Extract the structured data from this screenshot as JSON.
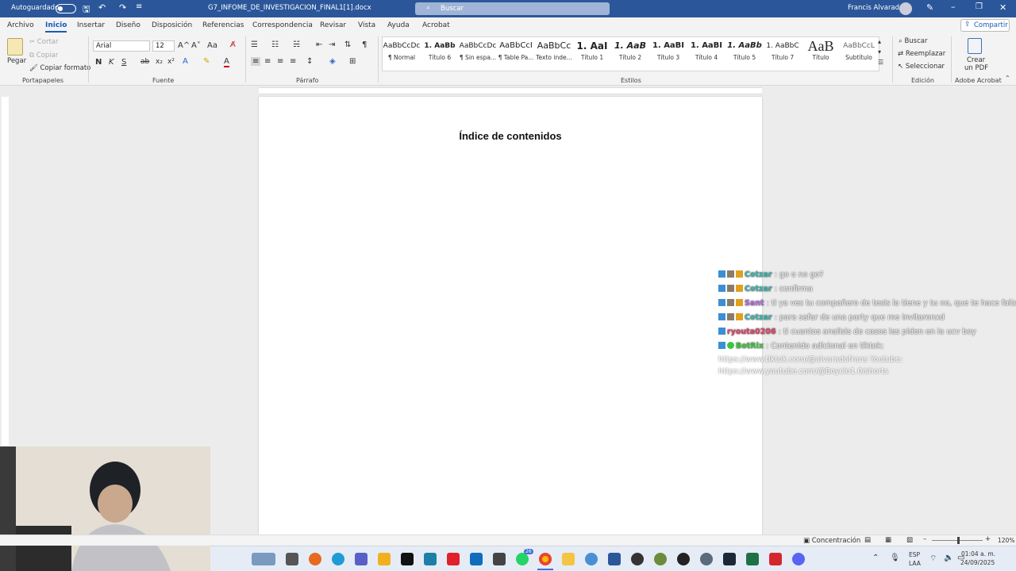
{
  "titlebar": {
    "autosave_label": "Autoguardado",
    "filename": "G7_INFOME_DE_INVESTIGACION_FINAL1[1].docx",
    "search_placeholder": "Buscar",
    "user_name": "Francis Alvarado"
  },
  "menu": {
    "tabs": [
      "Archivo",
      "Inicio",
      "Insertar",
      "Diseño",
      "Disposición",
      "Referencias",
      "Correspondencia",
      "Revisar",
      "Vista",
      "Ayuda",
      "Acrobat"
    ],
    "active": "Inicio",
    "share_label": "Compartir"
  },
  "ribbon": {
    "clipboard": {
      "paste": "Pegar",
      "cut": "Cortar",
      "copy": "Copiar",
      "format_painter": "Copiar formato",
      "group": "Portapapeles"
    },
    "font": {
      "name": "Arial",
      "size": "12",
      "bold": "N",
      "italic": "K",
      "underline": "S",
      "strike": "ab",
      "sub": "x₂",
      "sup": "x²",
      "case": "Aa",
      "grow": "A^",
      "shrink": "A˅",
      "group": "Fuente"
    },
    "paragraph": {
      "group": "Párrafo"
    },
    "styles": {
      "group": "Estilos",
      "items": [
        {
          "preview": "AaBbCcDc",
          "name": "¶ Normal"
        },
        {
          "preview": "1. AaBb",
          "name": "Título 6"
        },
        {
          "preview": "AaBbCcDc",
          "name": "¶ Sin espa..."
        },
        {
          "preview": "AaBbCcI",
          "name": "¶ Table Pa..."
        },
        {
          "preview": "AaBbCc",
          "name": "Texto inde..."
        },
        {
          "preview": "1. AaI",
          "name": "Título 1"
        },
        {
          "preview": "1. AaB",
          "name": "Título 2"
        },
        {
          "preview": "1. AaBI",
          "name": "Título 3"
        },
        {
          "preview": "1. AaBI",
          "name": "Título 4"
        },
        {
          "preview": "1. AaBb",
          "name": "Título 5"
        },
        {
          "preview": "1. AaBbC",
          "name": "Título 7"
        },
        {
          "preview": "AaB",
          "name": "Título"
        },
        {
          "preview": "AaBbCcL",
          "name": "Subtítulo"
        }
      ]
    },
    "editing": {
      "find": "Buscar",
      "replace": "Reemplazar",
      "select": "Seleccionar",
      "group": "Edición"
    },
    "acrobat": {
      "create": "Crear",
      "pdf": "un PDF",
      "group": "Adobe Acrobat"
    }
  },
  "document": {
    "heading": "Índice de contenidos"
  },
  "chat": [
    {
      "user": "Cotzar",
      "user_color": "#3bb7b0",
      "text": ": go o no go?"
    },
    {
      "user": "Cotzar",
      "user_color": "#3bb7b0",
      "text": ": confirma"
    },
    {
      "user": "Sant",
      "user_color": "#b56be0",
      "text": ": ti ya ves tu compañero de tesis la tiene y tu no, que te hace falta"
    },
    {
      "user": "Cotzar",
      "user_color": "#3bb7b0",
      "text": ": para safar de una party que me invitaronxd"
    },
    {
      "user": "ryouta0206",
      "user_color": "#e0456a",
      "text": ": ti cuantos analisis de casos les piden en la ucv boy"
    },
    {
      "user": "BotRix",
      "user_color": "#3cc63c",
      "text": ": Contenido adicional en tiktok:"
    }
  ],
  "chat_links": [
    "https://www.tiktok.com/@alvaradofrans Youtube:",
    "https://www.youtube.com/@Boyclo1.0/shorts"
  ],
  "statusbar": {
    "focus": "Concentración",
    "zoom": "120%"
  },
  "taskbar": {
    "lang1": "ESP",
    "lang2": "LAA",
    "time": "01:04 a. m.",
    "date": "24/09/2025",
    "badge": "26"
  }
}
